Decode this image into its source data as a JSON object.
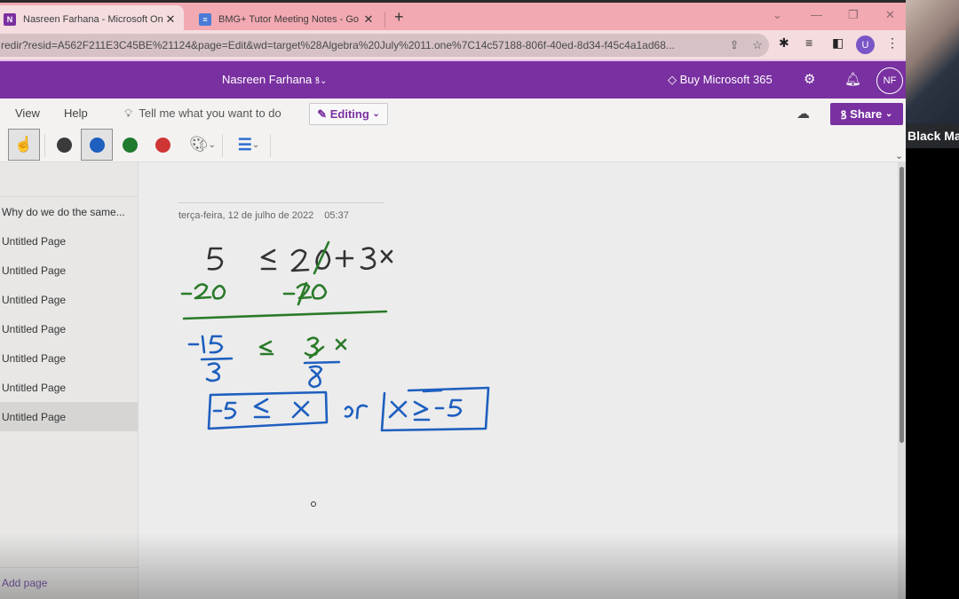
{
  "browser": {
    "tabs": [
      {
        "title": "Nasreen Farhana - Microsoft One",
        "icon": "onenote-icon",
        "active": true
      },
      {
        "title": "BMG+ Tutor Meeting Notes - Go",
        "icon": "google-docs-icon",
        "active": false
      }
    ],
    "new_tab": "+",
    "window_controls": {
      "dropdown": "⌄",
      "minimize": "—",
      "restore": "❐",
      "close": "✕"
    },
    "url": "redir?resid=A562F211E3C45BE%21124&page=Edit&wd=target%28Algebra%20July%2011.one%7C14c57188-806f-40ed-8d34-f45c4a1ad68...",
    "profile_initial": "U"
  },
  "header": {
    "user_name": "Nasreen Farhana",
    "buy_label": "Buy Microsoft 365",
    "avatar_initials": "NF"
  },
  "ribbon": {
    "menus": [
      "View",
      "Help"
    ],
    "tell_me": "Tell me what you want to do",
    "editing_label": "Editing",
    "share_label": "Share",
    "pen_colors": [
      "#3a3a3a",
      "#1e5fbf",
      "#1f7a2e",
      "#d03535"
    ],
    "selected_color_index": 1
  },
  "sidebar": {
    "pages": [
      {
        "title": "Why do we do the same...",
        "selected": false
      },
      {
        "title": "Untitled Page",
        "selected": false
      },
      {
        "title": "Untitled Page",
        "selected": false
      },
      {
        "title": "Untitled Page",
        "selected": false
      },
      {
        "title": "Untitled Page",
        "selected": false
      },
      {
        "title": "Untitled Page",
        "selected": false
      },
      {
        "title": "Untitled Page",
        "selected": false
      },
      {
        "title": "Untitled Page",
        "selected": true
      }
    ],
    "add_page": "Add page"
  },
  "page": {
    "date": "terça-feira, 12 de julho de 2022",
    "time": "05:37",
    "handwriting": {
      "line1": "5 ≤ 20 + 3x",
      "line2": "-20   -20",
      "line3": "-15/3 ≤ 3x/3",
      "line4": "-5 ≤ x  or  x ≥ -5"
    }
  },
  "webcam": {
    "label": "Black Ma"
  }
}
